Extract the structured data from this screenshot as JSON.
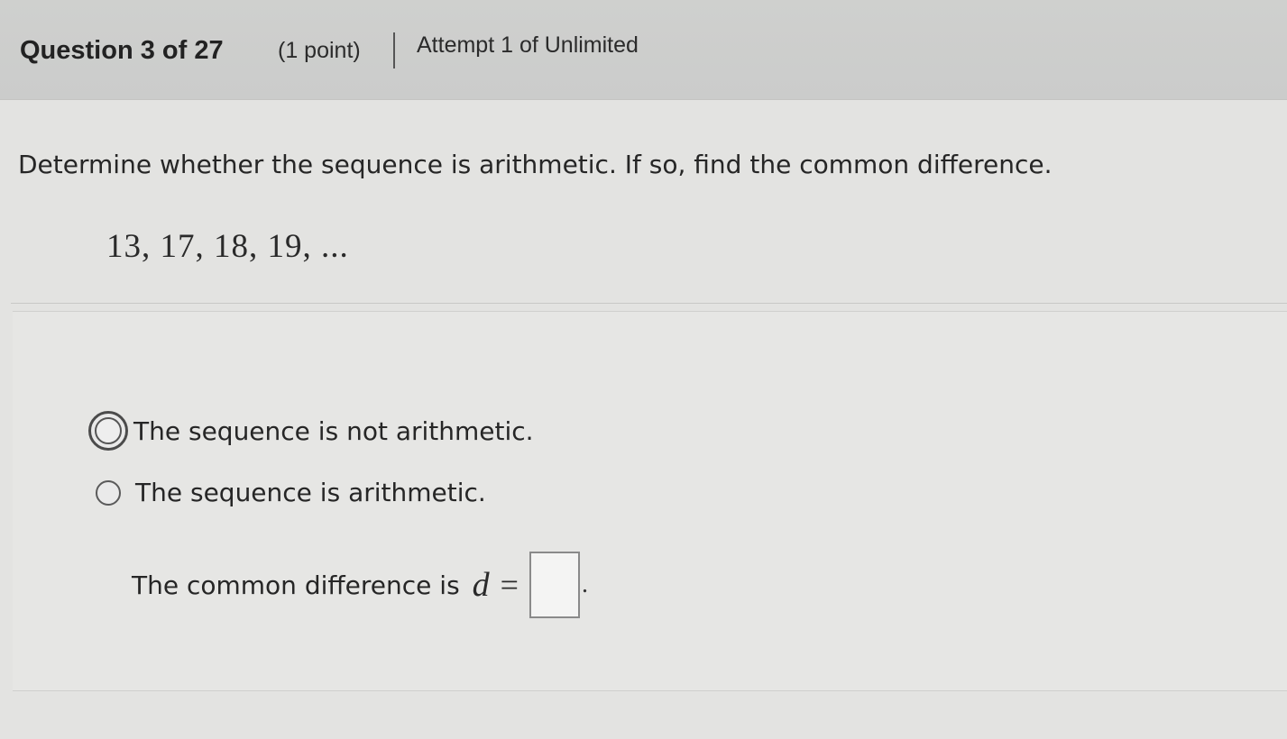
{
  "header": {
    "question_label": "Question 3 of 27",
    "points_label": "(1 point)",
    "attempt_label": "Attempt 1 of Unlimited"
  },
  "question": {
    "prompt": "Determine whether the sequence is arithmetic. If so, find the common difference.",
    "sequence": "13,  17,  18,  19, ..."
  },
  "options": [
    {
      "label": "The sequence is not arithmetic.",
      "focused": true
    },
    {
      "label": "The sequence is arithmetic.",
      "focused": false
    }
  ],
  "common_difference": {
    "prefix": "The common difference is",
    "variable": "d",
    "equals": "=",
    "value": "",
    "suffix": "."
  }
}
